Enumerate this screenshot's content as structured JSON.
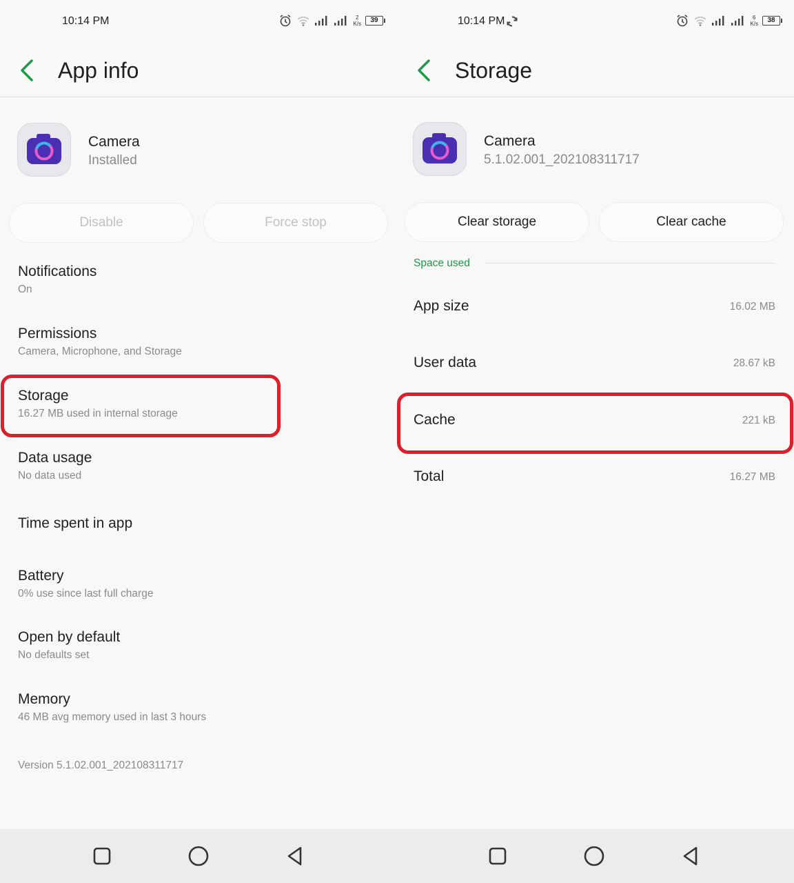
{
  "left": {
    "status": {
      "time": "10:14 PM",
      "speed_value": "2",
      "speed_unit": "K/s",
      "battery": "39"
    },
    "title": "App info",
    "app": {
      "name": "Camera",
      "subtitle": "Installed"
    },
    "buttons": {
      "primary": "Disable",
      "secondary": "Force stop"
    },
    "items": [
      {
        "title": "Notifications",
        "subtitle": "On"
      },
      {
        "title": "Permissions",
        "subtitle": "Camera, Microphone, and Storage"
      },
      {
        "title": "Storage",
        "subtitle": "16.27 MB used in internal storage"
      },
      {
        "title": "Data usage",
        "subtitle": "No data used"
      },
      {
        "title": "Time spent in app",
        "subtitle": ""
      },
      {
        "title": "Battery",
        "subtitle": "0% use since last full charge"
      },
      {
        "title": "Open by default",
        "subtitle": "No defaults set"
      },
      {
        "title": "Memory",
        "subtitle": "46 MB avg memory used in last 3 hours"
      }
    ],
    "version": "Version 5.1.02.001_202108311717"
  },
  "right": {
    "status": {
      "time": "10:14 PM",
      "speed_value": "6",
      "speed_unit": "K/s",
      "battery": "38"
    },
    "title": "Storage",
    "app": {
      "name": "Camera",
      "subtitle": "5.1.02.001_202108311717"
    },
    "buttons": {
      "primary": "Clear storage",
      "secondary": "Clear cache"
    },
    "section_label": "Space used",
    "rows": [
      {
        "label": "App size",
        "value": "16.02 MB"
      },
      {
        "label": "User data",
        "value": "28.67 kB"
      },
      {
        "label": "Cache",
        "value": "221 kB"
      },
      {
        "label": "Total",
        "value": "16.27 MB"
      }
    ]
  },
  "colors": {
    "accent_green": "#1b9a45",
    "highlight_red": "#d9202b",
    "icon_purple": "#4a2fb3"
  },
  "icons": [
    "back-icon",
    "alarm-icon",
    "wifi-icon",
    "signal-icon",
    "battery-icon",
    "sync-icon",
    "camera-app-icon",
    "recent-apps-icon",
    "home-icon",
    "back-triangle-icon"
  ]
}
